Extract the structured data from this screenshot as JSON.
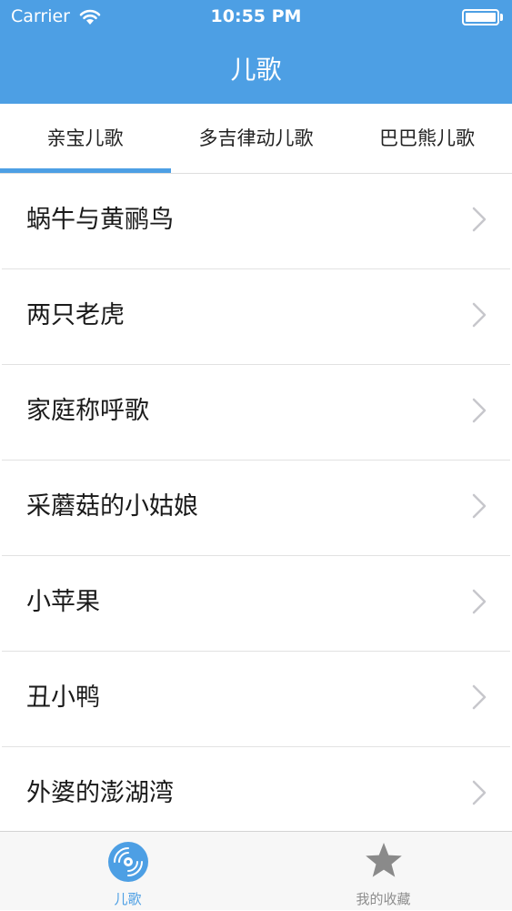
{
  "status_bar": {
    "carrier": "Carrier",
    "time": "10:55 PM",
    "battery_level": 1.0
  },
  "nav": {
    "title": "儿歌",
    "color": "#4d9fe4"
  },
  "tabs": [
    {
      "label": "亲宝儿歌",
      "selected": true
    },
    {
      "label": "多吉律动儿歌",
      "selected": false
    },
    {
      "label": "巴巴熊儿歌",
      "selected": false
    }
  ],
  "songs": [
    {
      "title": "蜗牛与黄鹂鸟"
    },
    {
      "title": "两只老虎"
    },
    {
      "title": "家庭称呼歌"
    },
    {
      "title": "采蘑菇的小姑娘"
    },
    {
      "title": "小苹果"
    },
    {
      "title": "丑小鸭"
    },
    {
      "title": "外婆的澎湖湾"
    }
  ],
  "tabbar": {
    "items": [
      {
        "label": "儿歌",
        "icon": "disc-icon",
        "selected": true
      },
      {
        "label": "我的收藏",
        "icon": "star-icon",
        "selected": false
      }
    ],
    "active_color": "#4d9fe4",
    "inactive_color": "#8e8e8e"
  }
}
